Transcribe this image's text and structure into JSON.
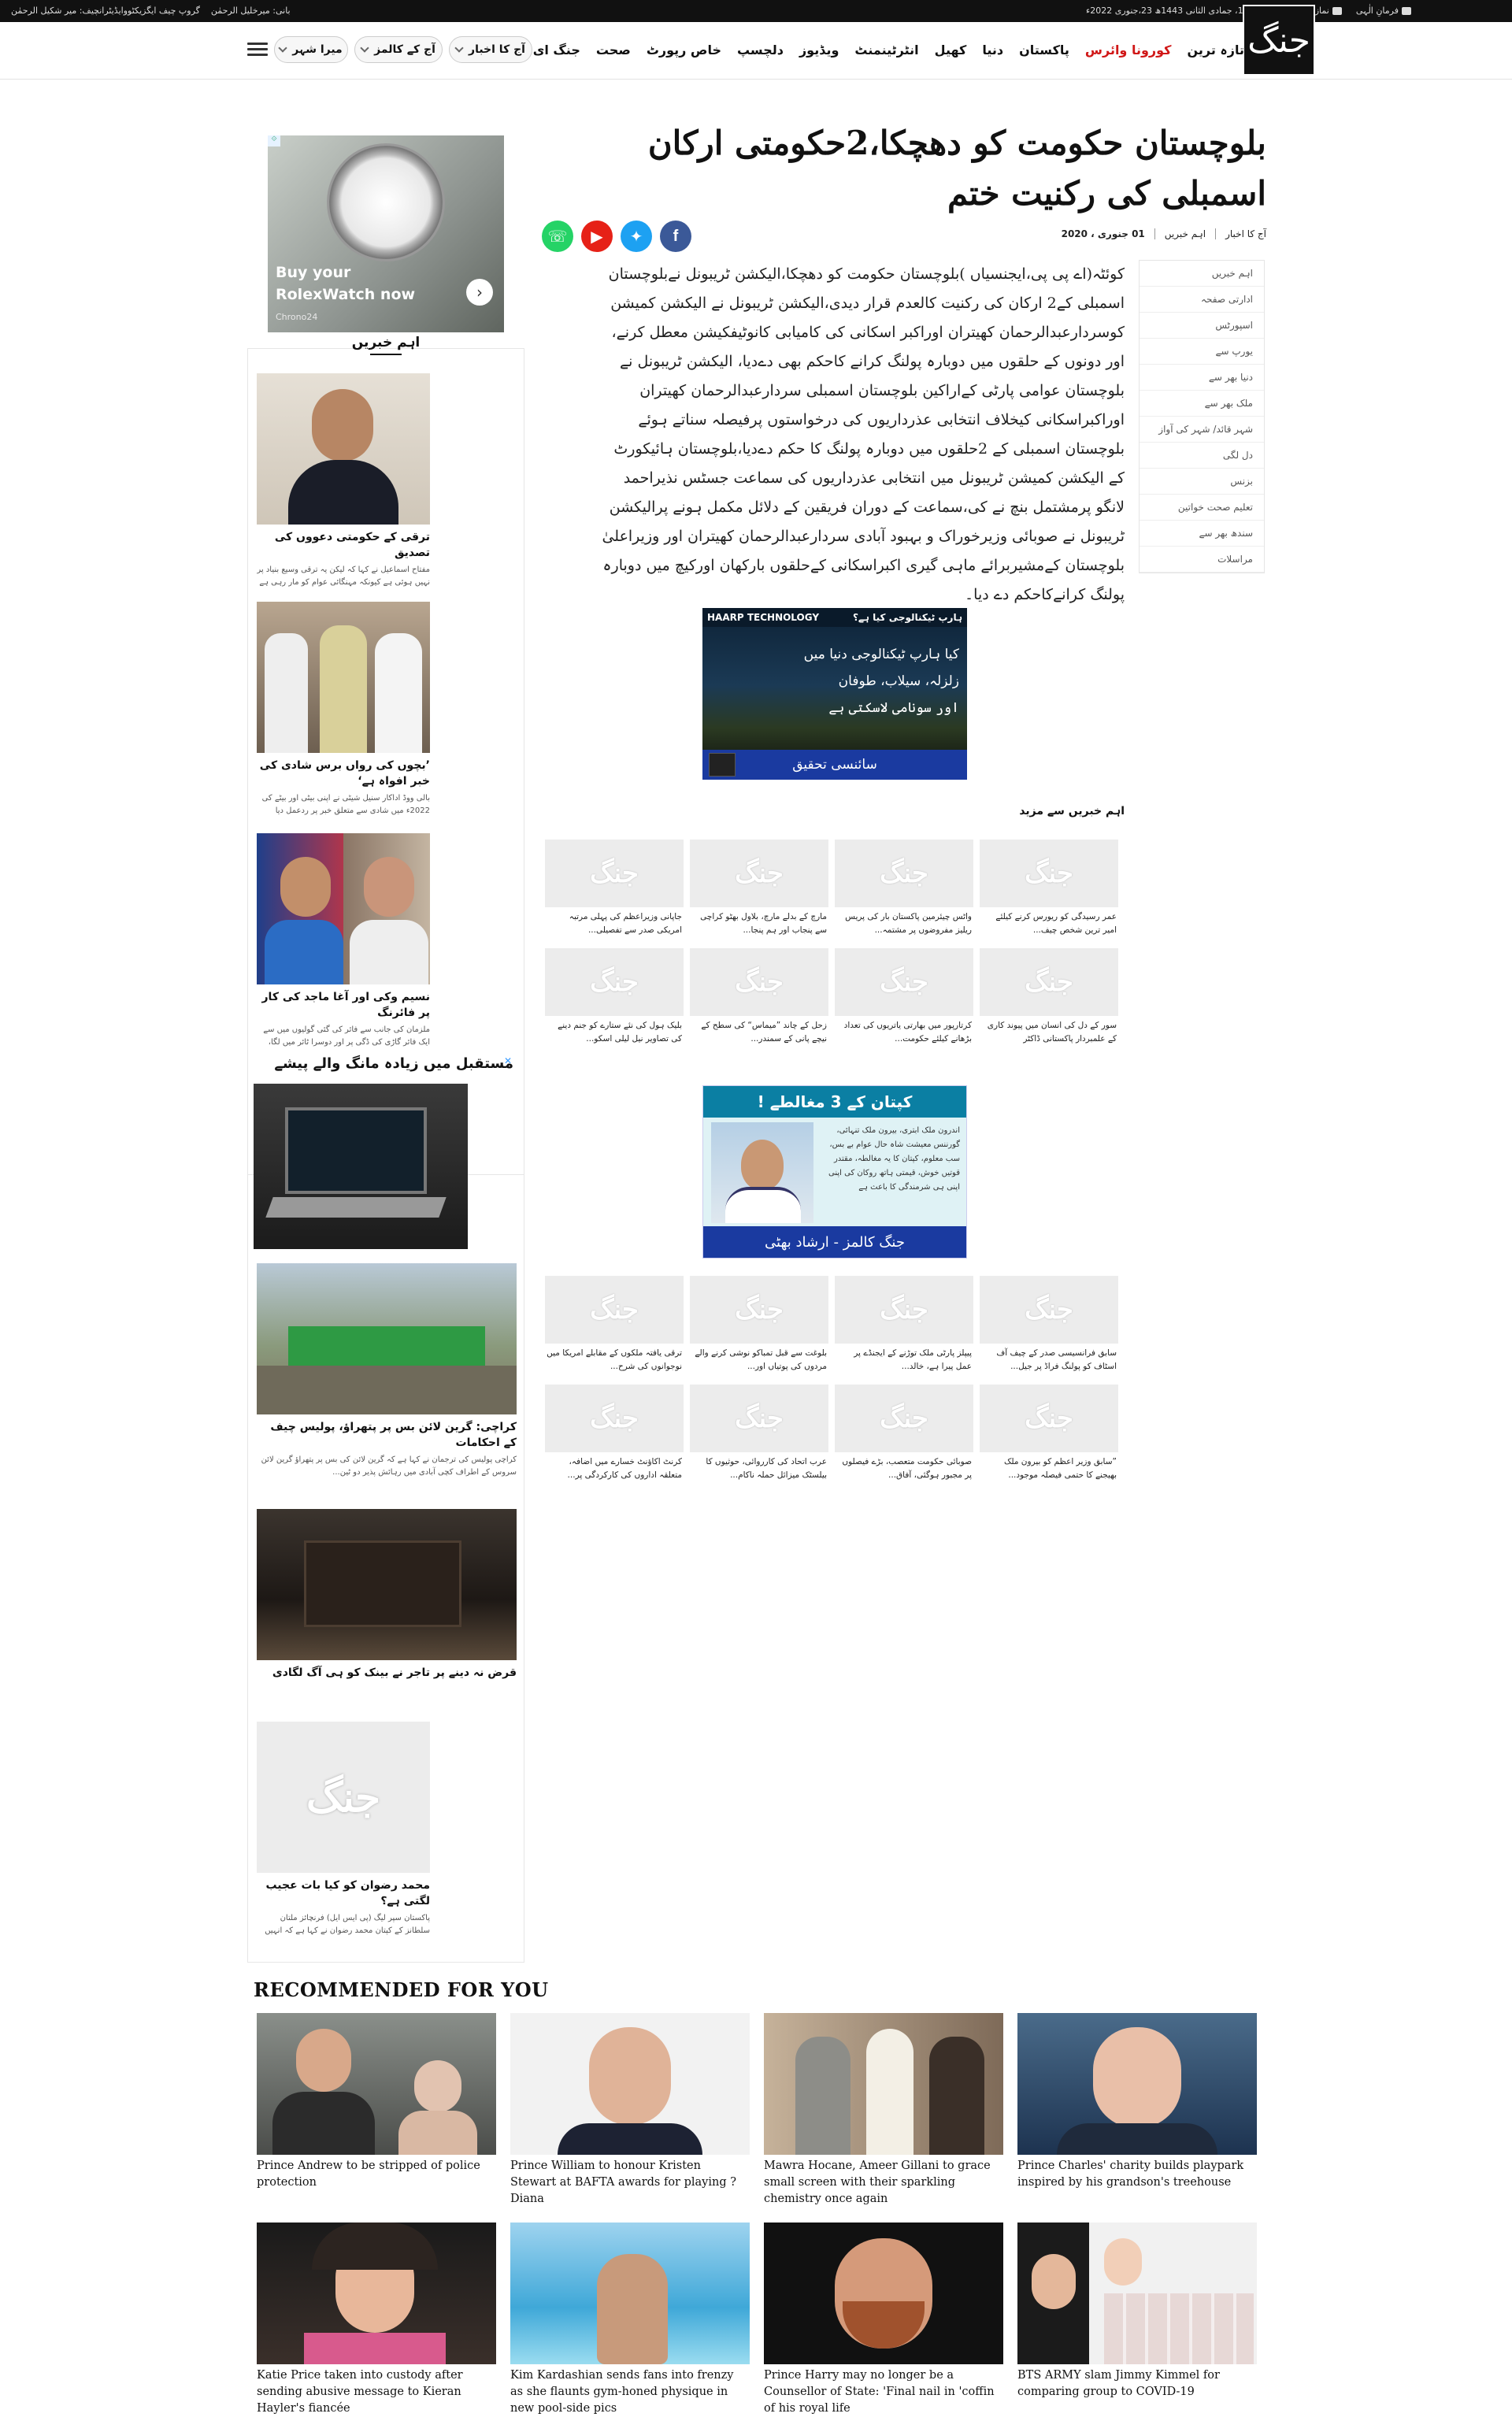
{
  "topbar": {
    "founder": "بانی: میرخلیل الرحمٰن",
    "group": "گروپ چیف ایگزیکٹووایڈیٹرانچیف: میر شکیل الرحمٰن",
    "date": "اتوار19، جمادی الثانی 1443ھ 23،جنوری 2022ء",
    "prayer": "نماز کے اوقات",
    "quran": "فرمانِ الٰہی"
  },
  "logo": "جنگ",
  "nav": [
    "تازہ ترین",
    "کورونا وائرس",
    "پاکستان",
    "دنیا",
    "کھیل",
    "انٹرٹینمنٹ",
    "ویڈیوز",
    "دلچسپ",
    "خاص رپورٹ",
    "صحت",
    "جنگ ای پیپر"
  ],
  "pills": [
    "آج کا اخبار",
    "آج کے کالمز",
    "میرا شہر"
  ],
  "article": {
    "headline": "بلوچستان حکومت کو دھچکا،2حکومتی ارکان اسمبلی کی رکنیت ختم",
    "meta": [
      "آج کا اخبار",
      "اہم خبریں",
      "01 جنوری ، 2020"
    ],
    "body": "کوئٹہ(اے پی پی،ایجنسیاں )بلوچستان حکومت کو دھچکا،الیکشن ٹریبونل نےبلوچستان اسمبلی کے2 ارکان کی رکنیت کالعدم قرار دیدی،الیکشن ٹریبونل نے الیکشن کمیشن کوسردارعبدالرحمان کھیتران اوراکبر اسکانی کی کامیابی کانوٹیفکیشن معطل کرنے، اور دونوں کے حلقوں میں دوبارہ پولنگ کرانے کاحکم بھی دےدیا، الیکشن ٹریبونل نے بلوچستان عوامی پارٹی کےاراکین بلوچستان اسمبلی سردارعبدالرحمان کھیتران اوراکبراسکانی کیخلاف انتخابی عذرداریوں کی درخواستوں پرفیصلہ سناتے ہوئے بلوچستان اسمبلی کے 2حلقوں میں دوبارہ پولنگ کا حکم دےدیا،بلوچستان ہائیکورٹ کے الیکشن کمیشن ٹریبونل میں انتخابی عذرداریوں کی سماعت جسٹس نذیراحمد لانگو پرمشتمل بنچ نے کی،سماعت کے دوران فریقین کے دلائل مکمل ہونے پرالیکشن ٹریبونل نے صوبائی وزیرخوراک و بہبود آبادی سردارعبدالرحمان کھیتران اور وزیراعلیٰ بلوچستان کےمشیربرائے ماہی گیری اکبراسکانی کےحلقوں بارکھان اورکیچ میں دوبارہ پولنگ کرانےکاحکم دے دیا۔"
  },
  "categories": [
    "اہم خبریں",
    "ادارتی صفحہ",
    "اسپورٹس",
    "یورپ سے",
    "دنیا بھر سے",
    "ملک بھر سے",
    "شہر قائد/ شہر کی آواز",
    "دل لگی",
    "بزنس",
    "تعلیم صحت خواتین",
    "سندھ بھر سے",
    "مراسلات"
  ],
  "ad1": {
    "header": "HAARP TECHNOLOGY",
    "header_ur": "ہارپ ٹیکنالوجی کیا ہے؟",
    "lines": [
      "کیا ہارپ ٹیکنالوجی دنیا میں",
      "زلزلہ، سیلاب، طوفان",
      "اور سونامی لاسکتی ہے"
    ],
    "footer": "سائنسی تحقیق"
  },
  "more_news_title": "اہم خبریں سے مزید",
  "thumb_logo": "جنگ",
  "grid1": [
    "عمر رسیدگی کو ریورس کرنے کیلئے امیر ترین شخص چیف...",
    "واٹس چیئرمین پاکستان بار کی پریس ریلیز مفروضوں پر مشتمہ...",
    "مارچ کے بدلے مارچ، بلاول بھٹو کراچی سے پنجاب اور ہم پنجا...",
    "جاپانی وزیراعظم کی پہلی مرتبہ امریکی صدر سے تفصیلی...",
    "سور کے دل کی انسان میں پیوند کاری کے علمبردار پاکستانی ڈاکٹر",
    "کرتارپور میں بھارتی یاتریوں کی تعداد بڑھانے کیلئے حکومت...",
    "زحل کے چاند ”میماس“ کی سطح کے نیچے پانی کے سمندر...",
    "بلیک ہول کی نئے ستارے کو جنم دینے کی تصاویر نیل لیلی اسکو..."
  ],
  "ad2": {
    "header": "کپتان کے 3 مغالطے !",
    "text": "اندرون ملک ابتری، بیرون ملک تنہائی، گورننس معیشت شاہ حال عوام بے بس، سب معلوم، کپتان کا یہ مغالطہ، مقتدر قوتیں خوش، قیمتی ہاتھ روکان کی اپنی اپنی ہی شرمندگی کا باعث ہے",
    "footer": "جنگ کالمز - ارشاد بھٹی"
  },
  "grid2": [
    "سابق فرانسیسی صدر کے چیف آف اسٹاف کو پولنگ فراڈ پر جیل...",
    "پیپلز پارٹی ملک توڑنے کے ایجنڈے پر عمل پیرا ہے، خالد...",
    "بلوغت سے قبل تمباکو نوشی کرنے والے مردوں کی پوتیاں اور...",
    "ترقی یافتہ ملکوں کے مقابلے امریکا میں نوجوانوں کی شرح...",
    "”سابق وزیر اعظم کو بیرون ملک بھیجنے کا حتمی فیصلہ موجود...",
    "صوبائی حکومت متعصب، بڑے فیصلوں پر مجبور ہوگئی، آفاق...",
    "عرب اتحاد کی کارروائی، حوثیوں کا بیلسٹک میزائل حملہ ناکام...",
    "کرنٹ اکاؤنٹ خسارے میں اضافہ، متعلقہ اداروں کی کارکردگی پر..."
  ],
  "rolex_ad": {
    "text": "Buy your RolexWatch now",
    "brand": "Chrono24",
    "adchoice": "⟐"
  },
  "sidebar": {
    "title": "اہم خبریں",
    "items": [
      {
        "title": "ترقی کے حکومتی دعووں کی تصدیق",
        "desc": "مفتاح اسماعیل نے کہا کہ لیکن یہ ترقی وسیع بنیاد پر نہیں ہوئی ہے کیونکہ مہنگائی عوام کو مار رہی ہے اور برآمدات میں اضافہ بھی..."
      },
      {
        "title": "’بچوں کی رواں برس شادی کی خبر افواہ ہے‘",
        "desc": "بالی ووڈ اداکار سنیل شیٹی نے اپنی بیٹی اور بیٹے کی 2022ء میں شادی سے متعلق خبر پر ردعمل دیا ہے..."
      },
      {
        "title": "نسیم وکی اور آغا ماجد کی کار پر فائرنگ",
        "desc": "ملزمان کی جانب سے فائر کی گئی گولیوں میں سے ایک فائر گاڑی کی ڈگی پر اور دوسرا ٹائر میں لگا، ملزمان کے خلاف تعاقب ریل بنا..."
      }
    ],
    "sponsored_title": "مستقبل میں زیادہ مانگ والے پیشے",
    "sponsored_close": "✕",
    "sponsored": [
      {
        "title": "",
        "desc": ""
      },
      {
        "title": "کراچی: گرین لائن بس پر پتھراؤ، پولیس چیف کے احکامات",
        "desc": "کراچی پولیس کی ترجمان نے کہا ہے کہ گرین لائن کی بس پر پتھراؤ گرین لائن سروس کے اطراف کچی آبادی میں رہائش پذیر دو ٹین..."
      },
      {
        "title": "قرض نہ دینے پر تاجر نے بینک کو ہی آگ لگادی",
        "desc": ""
      },
      {
        "title": "محمد رضوان کو کیا بات عجیب لگتی ہے؟",
        "desc": "پاکستان سپر لیگ (پی ایس ایل) فرنچائز ملتان سلطانز کے کپتان محمد رضوان نے کہا ہے کہ انہیں آؤٹ ہونا اچھا نہیں لگتا ہے..."
      }
    ]
  },
  "recommended": {
    "title": "RECOMMENDED FOR YOU",
    "items": [
      "Prince Andrew to be stripped of police protection",
      "Prince William to honour Kristen Stewart at BAFTA awards for playing ?Diana",
      "Mawra Hocane, Ameer Gillani to grace small screen with their sparkling chemistry once again",
      "Prince Charles' charity builds playpark inspired by his grandson's treehouse",
      "Katie Price taken into custody after sending abusive message to Kieran Hayler's fiancée",
      "Kim Kardashian sends fans into frenzy as she flaunts gym-honed physique in new pool-side pics",
      "Prince Harry may no longer be a Counsellor of State: 'Final nail in 'coffin of his royal life",
      "BTS ARMY slam Jimmy Kimmel for comparing group to COVID-19"
    ]
  },
  "colors": {
    "accent": "#d01717",
    "ad_blue": "#1a3aa0",
    "facebook": "#3b5998",
    "twitter": "#1da1f2",
    "youtube": "#e62117",
    "whatsapp": "#25d366"
  }
}
